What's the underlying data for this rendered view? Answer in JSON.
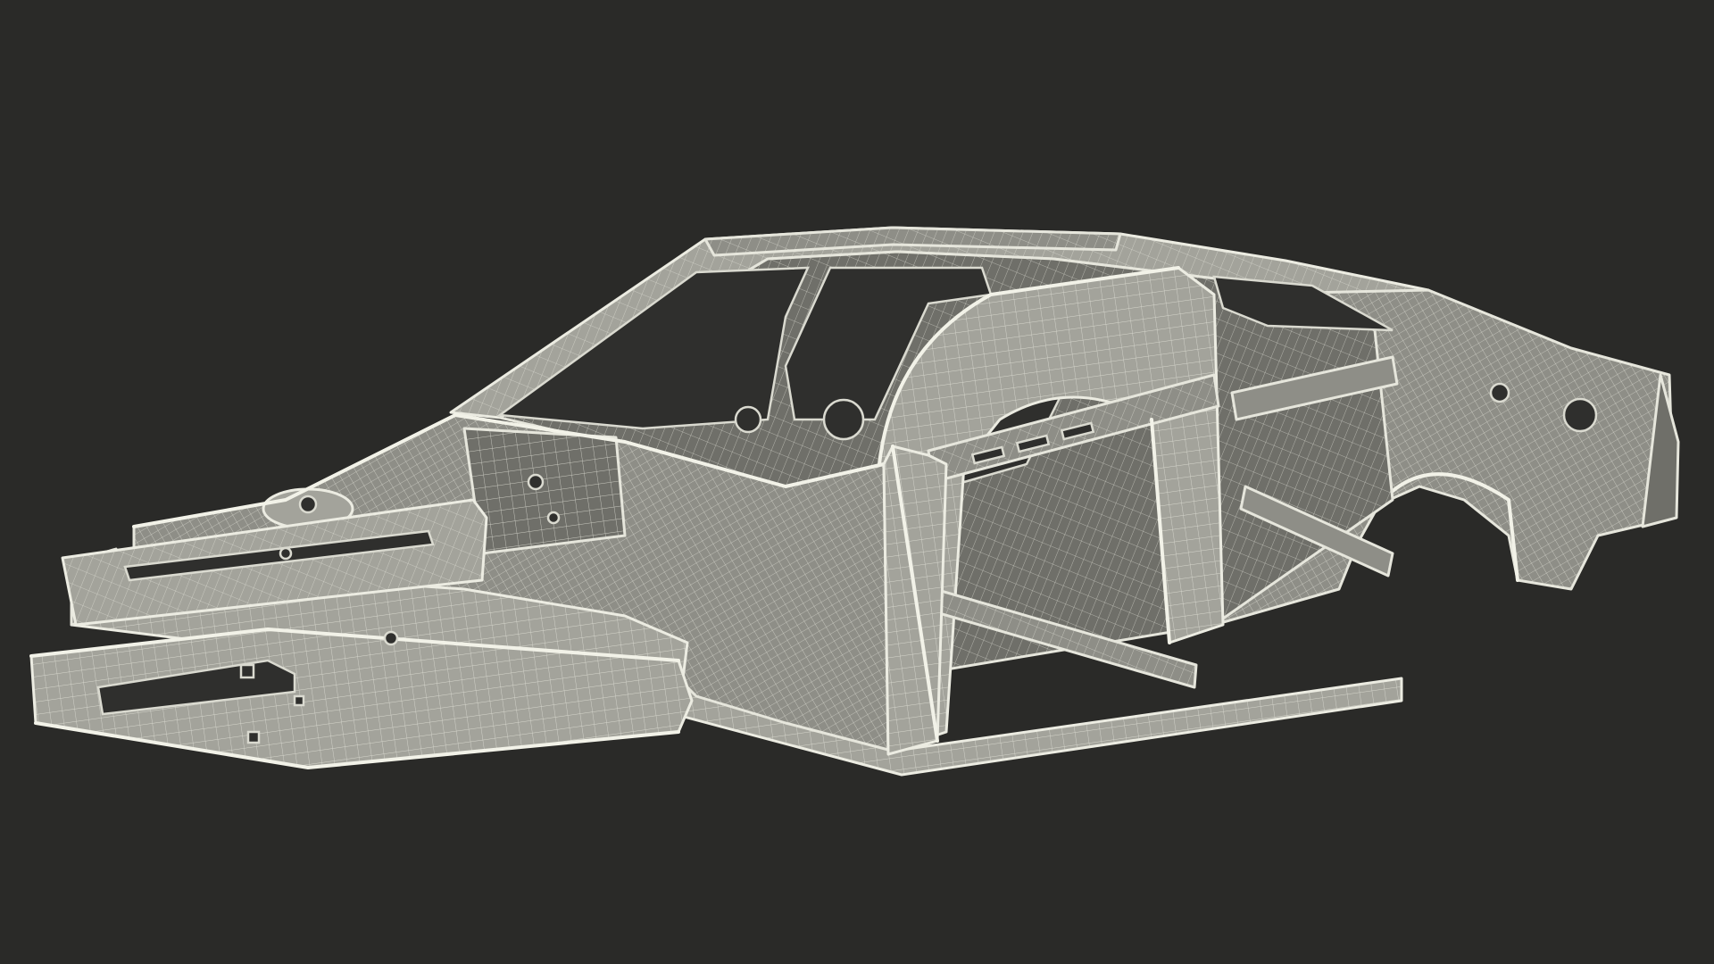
{
  "scene": {
    "subject": "car-body-in-white-wireframe",
    "colors": {
      "background": "#2a2a28",
      "wire": "#e6e6dc",
      "panel": "#8e8e87",
      "panel_dark": "#6f6f69",
      "panel_light": "#a3a39b",
      "opening": "#2f2f2d"
    }
  }
}
